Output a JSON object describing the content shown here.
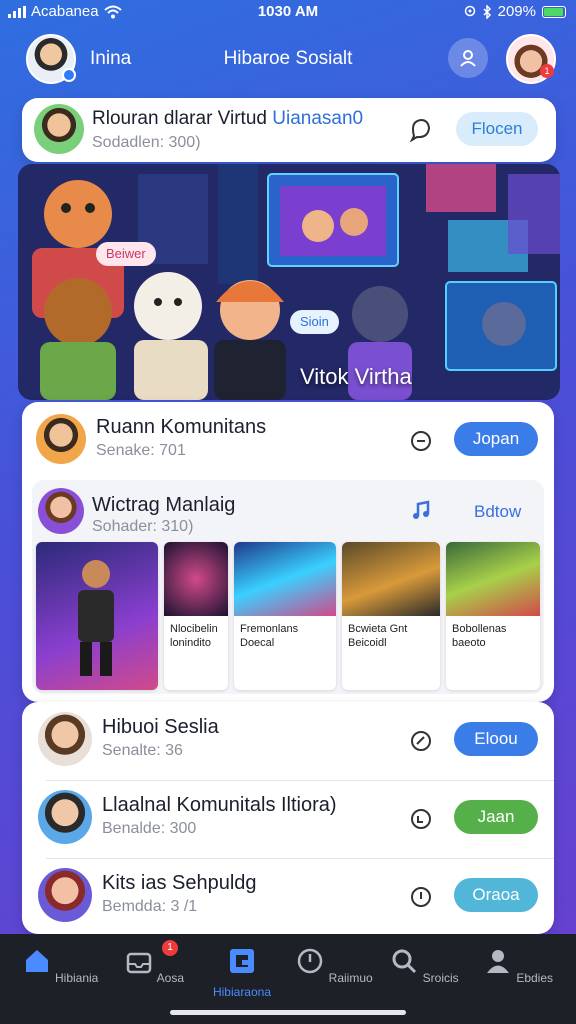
{
  "status": {
    "carrier": "Acabanea",
    "time": "1030 AM",
    "battery": "209%"
  },
  "header": {
    "user_name": "Inina",
    "app_title": "Hibaroe Sosialt",
    "notification_count": "1"
  },
  "top_card": {
    "title_part1": "Rlouran dlarar Virtud",
    "title_part2": "Uianasan0",
    "subtitle": "Sodadlen: 300)",
    "button": "Flocen"
  },
  "banner": {
    "chip_left": "Beiwer",
    "chip_mid": "Sioin",
    "caption": "Vitok Virtha"
  },
  "section": {
    "title": "Ruann Komunitans",
    "subtitle": "Senake: 701",
    "button": "Jopan",
    "featured": {
      "title": "Wictrag Manlaig",
      "subtitle": "Sohader: 310)",
      "follow": "Bdtow"
    },
    "tiles": [
      {
        "caption": ""
      },
      {
        "caption": "Nlocibelin\nlonindito"
      },
      {
        "caption": "Fremonlans\nDoecal"
      },
      {
        "caption": "Bcwieta Gnt\nBeicoidl"
      },
      {
        "caption": "Bobollenas\nbaeoto"
      }
    ]
  },
  "list": [
    {
      "title": "Hibuoi Seslia",
      "subtitle": "Senalte: 36",
      "button": "Eloou",
      "color": "#3a7de8"
    },
    {
      "title": "Llaalnal Komunitals Iltiora)",
      "subtitle": "Benalde: 300",
      "button": "Jaan",
      "color": "#56b04a"
    },
    {
      "title": "Kits ias Sehpuldg",
      "subtitle": "Bemdda: 3 /1",
      "button": "Oraoa",
      "color": "#52b6d9"
    }
  ],
  "nav": [
    {
      "label": "Hibiania",
      "icon": "home-icon"
    },
    {
      "label": "Aosa",
      "icon": "inbox-icon",
      "badge": "1"
    },
    {
      "label": "Hibiaraona",
      "icon": "community-icon",
      "active": true
    },
    {
      "label": "Raiimuo",
      "icon": "compass-icon"
    },
    {
      "label": "Sroicis",
      "icon": "search-icon"
    },
    {
      "label": "Ebdies",
      "icon": "profile-icon"
    }
  ]
}
